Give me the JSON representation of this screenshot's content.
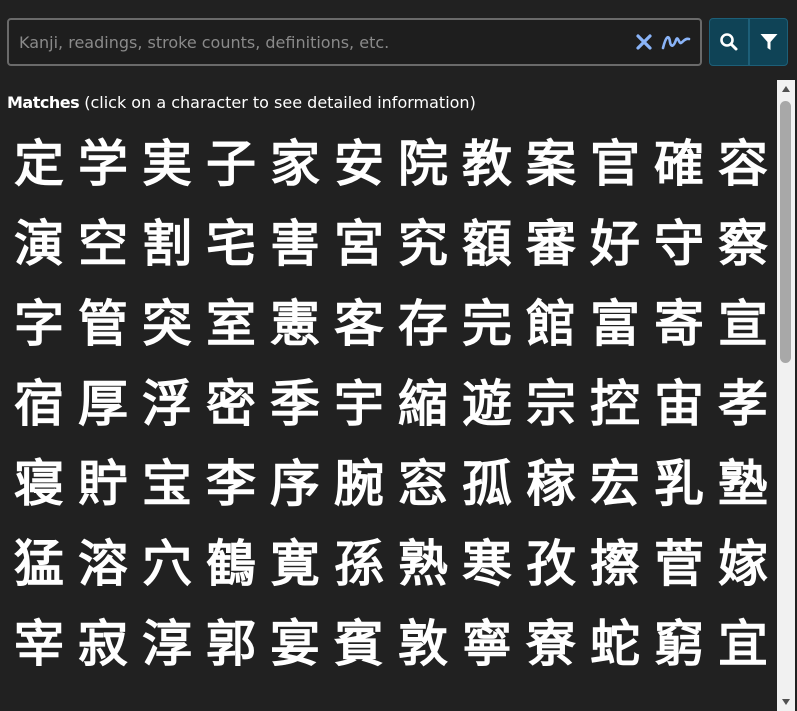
{
  "search": {
    "placeholder": "Kanji, readings, stroke counts, definitions, etc.",
    "value": ""
  },
  "matches": {
    "label": "Matches",
    "hint": "(click on a character to see detailed information)"
  },
  "kanji": [
    "定",
    "学",
    "実",
    "子",
    "家",
    "安",
    "院",
    "教",
    "案",
    "官",
    "確",
    "容",
    "演",
    "空",
    "割",
    "宅",
    "害",
    "宮",
    "究",
    "額",
    "審",
    "好",
    "守",
    "察",
    "字",
    "管",
    "突",
    "室",
    "憲",
    "客",
    "存",
    "完",
    "館",
    "富",
    "寄",
    "宣",
    "宿",
    "厚",
    "浮",
    "密",
    "季",
    "宇",
    "縮",
    "遊",
    "宗",
    "控",
    "宙",
    "孝",
    "寝",
    "貯",
    "宝",
    "李",
    "序",
    "腕",
    "窓",
    "孤",
    "稼",
    "宏",
    "乳",
    "塾",
    "猛",
    "溶",
    "穴",
    "鶴",
    "寛",
    "孫",
    "熟",
    "寒",
    "孜",
    "擦",
    "菅",
    "嫁",
    "宰",
    "寂",
    "淳",
    "郭",
    "宴",
    "賓",
    "敦",
    "寧",
    "寮",
    "蛇",
    "窮",
    "宜"
  ],
  "colors": {
    "background": "#212121",
    "button": "#0f4356",
    "clear_icon": "#8ab4f8"
  },
  "icons": {
    "clear": "close-icon",
    "handwriting": "handwriting-icon",
    "search": "search-icon",
    "filter": "filter-icon"
  }
}
